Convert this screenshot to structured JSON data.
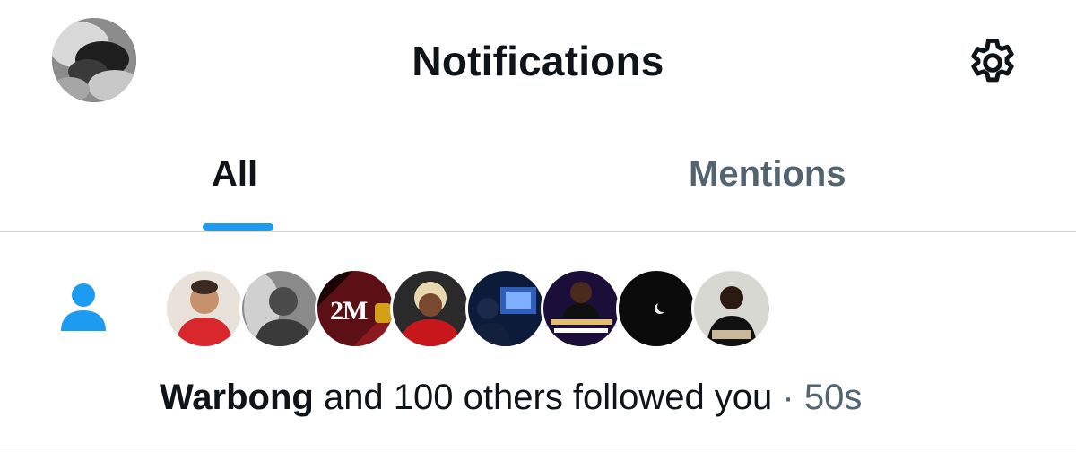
{
  "header": {
    "title": "Notifications",
    "avatar_icon": "profile-avatar",
    "settings_icon": "gear-icon"
  },
  "tabs": [
    {
      "label": "All",
      "active": true
    },
    {
      "label": "Mentions",
      "active": false
    }
  ],
  "colors": {
    "accent": "#1d9bf0",
    "text_primary": "#0f1419",
    "text_secondary": "#536471",
    "divider": "#cfd9de"
  },
  "notification": {
    "type_icon": "person-icon",
    "follower_avatars": [
      {
        "name": "follower-avatar-1"
      },
      {
        "name": "follower-avatar-2"
      },
      {
        "name": "follower-avatar-3",
        "text": "2M"
      },
      {
        "name": "follower-avatar-4"
      },
      {
        "name": "follower-avatar-5"
      },
      {
        "name": "follower-avatar-6"
      },
      {
        "name": "follower-avatar-7"
      },
      {
        "name": "follower-avatar-8"
      }
    ],
    "actor_name": "Warbong",
    "message": " and 100 others followed you",
    "separator": " · ",
    "time": "50s"
  }
}
